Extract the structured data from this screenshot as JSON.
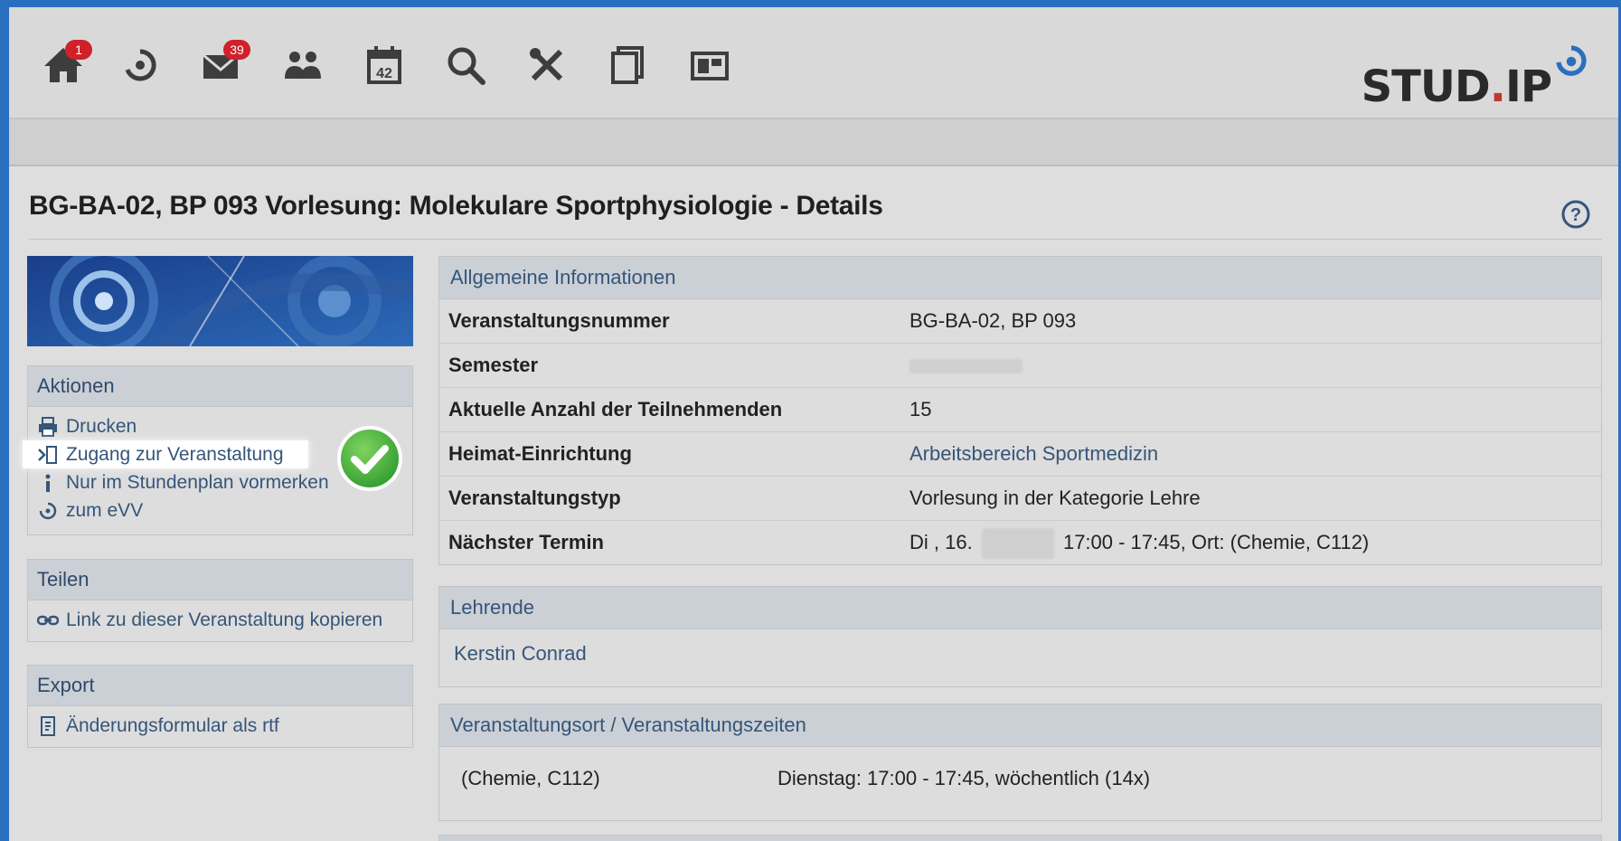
{
  "nav": {
    "home_badge": "1",
    "mail_badge": "39",
    "calendar_day": "42",
    "logo": {
      "main": "STUD",
      "dot": ".",
      "suffix": "IP"
    }
  },
  "page": {
    "title": "BG-BA-02, BP 093 Vorlesung: Molekulare Sportphysiologie - Details"
  },
  "sidebar": {
    "aktionen": {
      "heading": "Aktionen",
      "items": [
        {
          "label": "Drucken",
          "icon": "printer-icon"
        },
        {
          "label": "Zugang zur Veranstaltung",
          "icon": "enter-icon"
        },
        {
          "label": "Nur im Stundenplan vormerken",
          "icon": "info-icon"
        },
        {
          "label": "zum eVV",
          "icon": "refresh-icon"
        }
      ]
    },
    "teilen": {
      "heading": "Teilen",
      "items": [
        {
          "label": "Link zu dieser Veranstaltung kopieren",
          "icon": "link-icon"
        }
      ]
    },
    "export": {
      "heading": "Export",
      "items": [
        {
          "label": "Änderungsformular als rtf",
          "icon": "document-icon"
        }
      ]
    }
  },
  "general": {
    "heading": "Allgemeine Informationen",
    "rows": [
      {
        "key": "Veranstaltungsnummer",
        "value": "BG-BA-02, BP 093"
      },
      {
        "key": "Semester",
        "value": ""
      },
      {
        "key": "Aktuelle Anzahl der Teilnehmenden",
        "value": "15"
      },
      {
        "key": "Heimat-Einrichtung",
        "value": "Arbeitsbereich Sportmedizin"
      },
      {
        "key": "Veranstaltungstyp",
        "value": "Vorlesung in der Kategorie Lehre"
      },
      {
        "key": "Nächster Termin",
        "value_prefix": "Di , 16.",
        "value_suffix": "17:00 - 17:45, Ort: (Chemie, C112)"
      }
    ]
  },
  "lehrende": {
    "heading": "Lehrende",
    "name": "Kerstin Conrad"
  },
  "ort": {
    "heading": "Veranstaltungsort / Veranstaltungszeiten",
    "room": "(Chemie, C112)",
    "time": "Dienstag: 17:00 - 17:45, wöchentlich (14x)"
  },
  "colors": {
    "accent": "#35557a",
    "badge": "#d0202a",
    "check": "#3aa83a"
  }
}
